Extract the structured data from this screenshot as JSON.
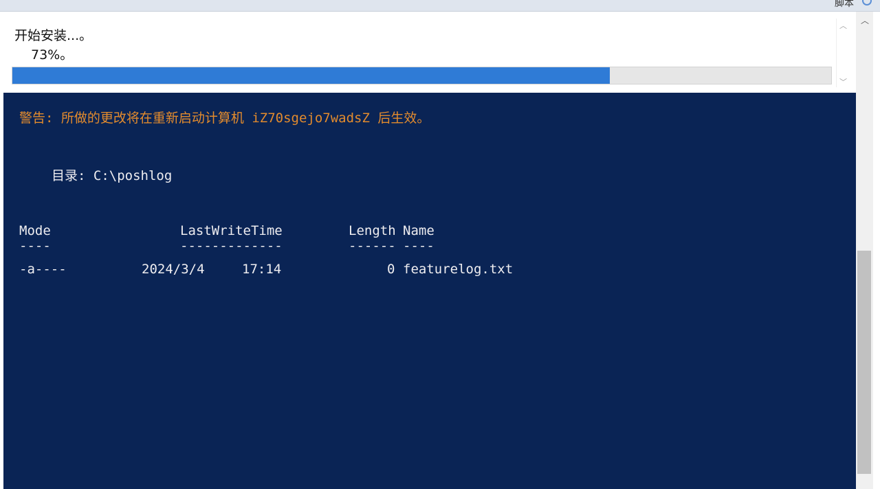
{
  "topbar": {
    "label": "脚本"
  },
  "progress": {
    "status": "开始安装...。",
    "percent_text": "73%。",
    "value": 0.73,
    "fill_color": "#2f7bd6",
    "scroll_up_icon": "chevron-up-icon",
    "scroll_down_icon": "chevron-down-icon"
  },
  "console": {
    "background": "#0a2455",
    "warning_color": "#e38b2d",
    "warning": "警告: 所做的更改将在重新启动计算机 iZ70sgejo7wadsZ 后生效。",
    "directory_line": "目录: C:\\poshlog",
    "table": {
      "headers": {
        "mode": "Mode",
        "lastwritetime": "LastWriteTime",
        "length": "Length",
        "name": "Name"
      },
      "dashes": {
        "mode": "----",
        "lastwritetime": "-------------",
        "length": "------",
        "name": "----"
      },
      "rows": [
        {
          "mode": "-a----",
          "date": "2024/3/4",
          "time": "17:14",
          "length": "0",
          "name": "featurelog.txt"
        }
      ]
    }
  },
  "scrollbar": {
    "up_icon": "chevron-up-icon"
  }
}
